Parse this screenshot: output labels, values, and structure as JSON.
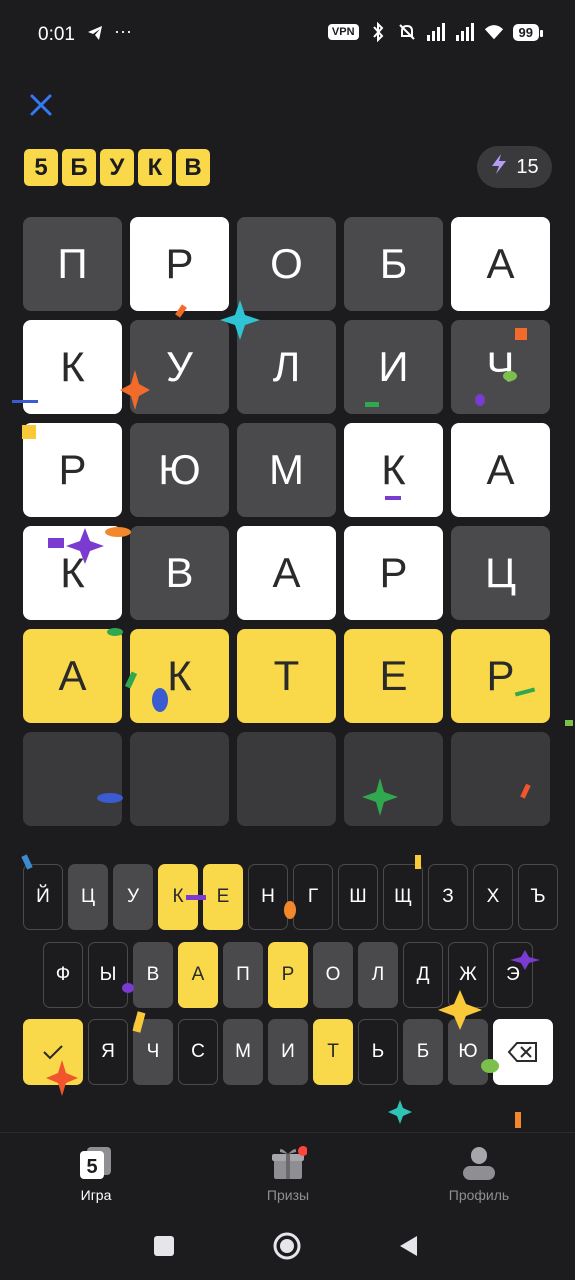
{
  "status_bar": {
    "time": "0:01",
    "vpn": "VPN",
    "battery": "99"
  },
  "header": {
    "logo_letters": [
      "5",
      "Б",
      "У",
      "К",
      "В"
    ],
    "energy_count": "15"
  },
  "board": {
    "rows": [
      [
        {
          "letter": "П",
          "state": "gray"
        },
        {
          "letter": "Р",
          "state": "white"
        },
        {
          "letter": "О",
          "state": "gray"
        },
        {
          "letter": "Б",
          "state": "gray"
        },
        {
          "letter": "А",
          "state": "white"
        }
      ],
      [
        {
          "letter": "К",
          "state": "white"
        },
        {
          "letter": "У",
          "state": "gray"
        },
        {
          "letter": "Л",
          "state": "gray"
        },
        {
          "letter": "И",
          "state": "gray"
        },
        {
          "letter": "Ч",
          "state": "gray"
        }
      ],
      [
        {
          "letter": "Р",
          "state": "white"
        },
        {
          "letter": "Ю",
          "state": "gray"
        },
        {
          "letter": "М",
          "state": "gray"
        },
        {
          "letter": "К",
          "state": "white"
        },
        {
          "letter": "А",
          "state": "white"
        }
      ],
      [
        {
          "letter": "К",
          "state": "white"
        },
        {
          "letter": "В",
          "state": "gray"
        },
        {
          "letter": "А",
          "state": "white"
        },
        {
          "letter": "Р",
          "state": "white"
        },
        {
          "letter": "Ц",
          "state": "gray"
        }
      ],
      [
        {
          "letter": "А",
          "state": "yellow"
        },
        {
          "letter": "К",
          "state": "yellow"
        },
        {
          "letter": "Т",
          "state": "yellow"
        },
        {
          "letter": "Е",
          "state": "yellow"
        },
        {
          "letter": "Р",
          "state": "yellow"
        }
      ],
      [
        {
          "letter": "",
          "state": "empty"
        },
        {
          "letter": "",
          "state": "empty"
        },
        {
          "letter": "",
          "state": "empty"
        },
        {
          "letter": "",
          "state": "empty"
        },
        {
          "letter": "",
          "state": "empty"
        }
      ]
    ]
  },
  "keyboard": {
    "row1": [
      {
        "label": "Й",
        "state": "default"
      },
      {
        "label": "Ц",
        "state": "gray"
      },
      {
        "label": "У",
        "state": "gray"
      },
      {
        "label": "К",
        "state": "yellow"
      },
      {
        "label": "Е",
        "state": "yellow"
      },
      {
        "label": "Н",
        "state": "default"
      },
      {
        "label": "Г",
        "state": "default"
      },
      {
        "label": "Ш",
        "state": "default"
      },
      {
        "label": "Щ",
        "state": "default"
      },
      {
        "label": "З",
        "state": "default"
      },
      {
        "label": "Х",
        "state": "default"
      },
      {
        "label": "Ъ",
        "state": "default"
      }
    ],
    "row2": [
      {
        "label": "Ф",
        "state": "default"
      },
      {
        "label": "Ы",
        "state": "default"
      },
      {
        "label": "В",
        "state": "gray"
      },
      {
        "label": "А",
        "state": "yellow"
      },
      {
        "label": "П",
        "state": "gray"
      },
      {
        "label": "Р",
        "state": "yellow"
      },
      {
        "label": "О",
        "state": "gray"
      },
      {
        "label": "Л",
        "state": "gray"
      },
      {
        "label": "Д",
        "state": "default"
      },
      {
        "label": "Ж",
        "state": "default"
      },
      {
        "label": "Э",
        "state": "default"
      }
    ],
    "row3": [
      {
        "label": "Я",
        "state": "default"
      },
      {
        "label": "Ч",
        "state": "gray"
      },
      {
        "label": "С",
        "state": "default"
      },
      {
        "label": "М",
        "state": "gray"
      },
      {
        "label": "И",
        "state": "gray"
      },
      {
        "label": "Т",
        "state": "yellow"
      },
      {
        "label": "Ь",
        "state": "default"
      },
      {
        "label": "Б",
        "state": "gray"
      },
      {
        "label": "Ю",
        "state": "gray"
      }
    ],
    "submit_icon": "checkmark-icon",
    "delete_icon": "backspace-icon"
  },
  "tabs": [
    {
      "label": "Игра",
      "icon": "game-logo-icon",
      "active": true
    },
    {
      "label": "Призы",
      "icon": "gift-icon",
      "active": false
    },
    {
      "label": "Профиль",
      "icon": "profile-icon",
      "active": false
    }
  ],
  "colors": {
    "yellow": "#f9d94a",
    "gray": "#4a4a4c",
    "background": "#1c1c1e",
    "accent_blue": "#3478f6",
    "tab_inactive": "#8e8e93"
  }
}
